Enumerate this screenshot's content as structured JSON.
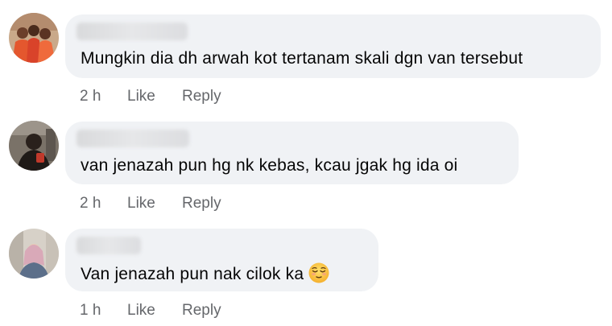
{
  "comments": [
    {
      "text": "Mungkin dia dh arwah kot tertanam skali dgn van tersebut",
      "time": "2 h",
      "like_label": "Like",
      "reply_label": "Reply"
    },
    {
      "text": "van jenazah pun hg nk kebas, kcau jgak hg ida oi",
      "time": "2 h",
      "like_label": "Like",
      "reply_label": "Reply"
    },
    {
      "text": "Van jenazah pun nak cilok ka",
      "emoji": "relieved-face-emoji",
      "time": "1 h",
      "like_label": "Like",
      "reply_label": "Reply"
    }
  ],
  "colors": {
    "bubble_background": "#f0f2f5",
    "meta_text": "#65676b",
    "comment_text": "#050505"
  }
}
